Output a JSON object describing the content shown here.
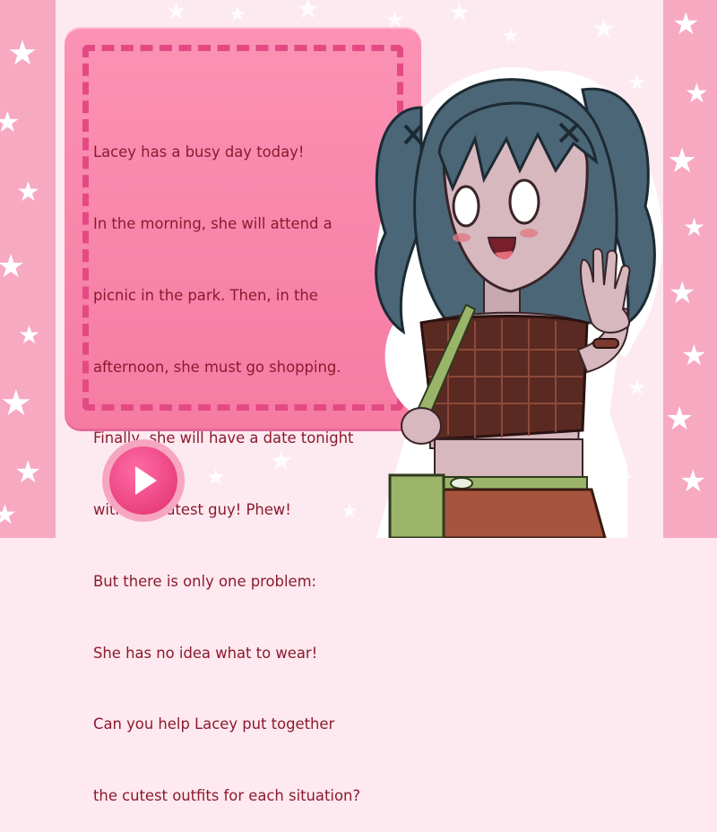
{
  "story": {
    "lines": [
      "Lacey has a busy day today!",
      "In the morning, she will attend a",
      "picnic in the park. Then, in the",
      "afternoon, she must go shopping.",
      "Finally, she will have a date tonight",
      "with the cutest guy! Phew!",
      "But there is only one problem:",
      "She has no idea what to wear!",
      "Can you help Lacey put together",
      "the cutest outfits for each situation?"
    ]
  },
  "colors": {
    "sidebar": "#f7a9c1",
    "card": "#f883aa",
    "dash": "#e34a83",
    "text": "#8b1a2e",
    "button": "#e0306f"
  },
  "icons": {
    "play": "play-icon",
    "stars": "star-icon"
  }
}
